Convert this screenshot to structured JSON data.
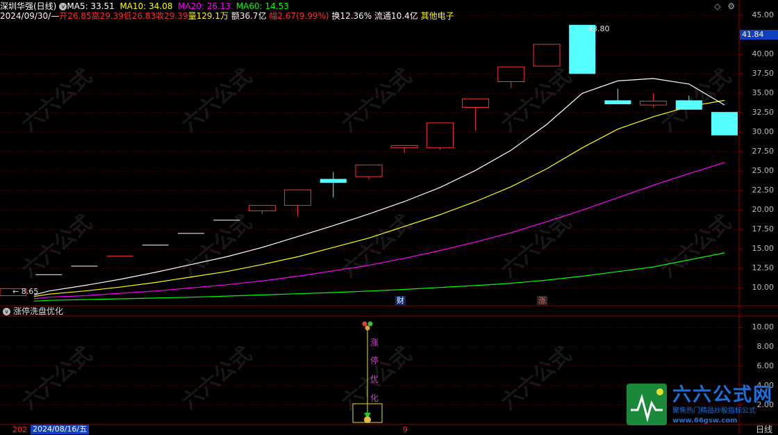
{
  "header": {
    "title": "深圳华强(日线)",
    "ma5": "MA5: 33.51",
    "ma10": "MA10: 34.08",
    "ma20": "MA20: 26.13",
    "ma60": "MA60: 14.53",
    "date": "2024/09/30/—",
    "open": "开26.85",
    "high": "高29.39",
    "low": "低26.83",
    "close": "收29.39",
    "volume": "量129.1万",
    "amount": "额36.7亿",
    "change": "幅2.67(9.99%)",
    "turnover": "换12.36%",
    "float_cap": "流通10.4亿",
    "sector": "其他电子"
  },
  "window_controls": {
    "expand": "◇",
    "menu": "⚙"
  },
  "price_axis": {
    "current_price": "41.84",
    "labels": [
      "45.00",
      "40.00",
      "37.50",
      "35.00",
      "32.50",
      "30.00",
      "27.50",
      "25.00",
      "22.50",
      "20.00",
      "17.50",
      "15.00",
      "12.50",
      "10.00"
    ]
  },
  "annotations": {
    "high_label": "43.80",
    "low_label": "8.65",
    "marker_cai": "财",
    "marker_zhang": "涨"
  },
  "indicator": {
    "name": "涨停洗盘优化",
    "labels": [
      "10.00",
      "8.00",
      "6.00",
      "4.00",
      "2.00"
    ],
    "vertical_text": [
      "涨",
      "停",
      "优",
      "化"
    ]
  },
  "footer": {
    "date_left": "202",
    "cursor_date": "2024/08/16/五",
    "mid_label": "9",
    "period": "日线"
  },
  "logo": {
    "title": "六六公式网",
    "subtitle": "聚焦热门精品炒股指标公式",
    "url": "www.66gsw.com"
  },
  "colors": {
    "up": "#ff3030",
    "down": "#54ffff",
    "ma5": "#ffffff",
    "ma10": "#ffff00",
    "ma20": "#ff00ff",
    "ma60": "#00ff00",
    "accent_blue": "#1040c0"
  },
  "chart_data": {
    "type": "candlestick",
    "ylim": [
      8,
      46
    ],
    "candles": [
      {
        "o": 9.0,
        "c": 9.9,
        "h": 9.9,
        "l": 9.0
      },
      {
        "o": 11.7,
        "c": 11.7,
        "h": 11.7,
        "l": 11.7
      },
      {
        "o": 12.8,
        "c": 12.8,
        "h": 12.8,
        "l": 12.8
      },
      {
        "o": 14.0,
        "c": 14.1,
        "h": 14.1,
        "l": 14.0
      },
      {
        "o": 15.5,
        "c": 15.5,
        "h": 15.5,
        "l": 15.5
      },
      {
        "o": 17.0,
        "c": 17.0,
        "h": 17.0,
        "l": 17.0
      },
      {
        "o": 18.7,
        "c": 18.7,
        "h": 18.7,
        "l": 18.7
      },
      {
        "o": 19.9,
        "c": 20.6,
        "h": 20.6,
        "l": 19.5
      },
      {
        "o": 20.6,
        "c": 22.6,
        "h": 22.6,
        "l": 19.2
      },
      {
        "o": 24.0,
        "c": 23.5,
        "h": 24.9,
        "l": 21.6
      },
      {
        "o": 24.3,
        "c": 25.8,
        "h": 25.8,
        "l": 23.9
      },
      {
        "o": 28.0,
        "c": 28.3,
        "h": 28.3,
        "l": 27.3
      },
      {
        "o": 28.0,
        "c": 31.2,
        "h": 31.2,
        "l": 27.7
      },
      {
        "o": 33.2,
        "c": 34.3,
        "h": 34.3,
        "l": 30.2
      },
      {
        "o": 36.5,
        "c": 38.4,
        "h": 38.4,
        "l": 35.7
      },
      {
        "o": 38.5,
        "c": 41.3,
        "h": 41.3,
        "l": 38.5
      },
      {
        "o": 43.8,
        "c": 37.5,
        "h": 43.8,
        "l": 37.5
      },
      {
        "o": 34.1,
        "c": 33.6,
        "h": 35.6,
        "l": 33.6
      },
      {
        "o": 33.5,
        "c": 34.0,
        "h": 35.0,
        "l": 33.2
      },
      {
        "o": 34.1,
        "c": 32.9,
        "h": 34.7,
        "l": 32.9
      },
      {
        "o": 32.6,
        "c": 29.6,
        "h": 32.6,
        "l": 29.6
      }
    ],
    "ma5": [
      9.1,
      9.6,
      10.3,
      11.1,
      12.0,
      13.0,
      14.0,
      15.2,
      16.6,
      18.0,
      19.5,
      21.1,
      22.9,
      25.1,
      27.7,
      31.0,
      35.0,
      36.6,
      36.9,
      36.2,
      33.5
    ],
    "ma10": [
      8.9,
      9.2,
      9.6,
      10.1,
      10.7,
      11.4,
      12.1,
      13.0,
      14.0,
      15.2,
      16.4,
      17.9,
      19.4,
      21.1,
      23.0,
      25.3,
      28.0,
      30.4,
      32.0,
      33.3,
      34.1
    ],
    "ma20": [
      8.6,
      8.8,
      9.0,
      9.3,
      9.6,
      10.0,
      10.4,
      10.9,
      11.5,
      12.2,
      12.9,
      13.8,
      14.8,
      15.9,
      17.1,
      18.5,
      20.0,
      21.6,
      23.2,
      24.7,
      26.1
    ],
    "ma60": [
      8.3,
      8.4,
      8.5,
      8.6,
      8.7,
      8.8,
      8.95,
      9.1,
      9.25,
      9.4,
      9.6,
      9.8,
      10.05,
      10.3,
      10.6,
      11.0,
      11.5,
      12.1,
      12.7,
      13.6,
      14.5
    ]
  }
}
